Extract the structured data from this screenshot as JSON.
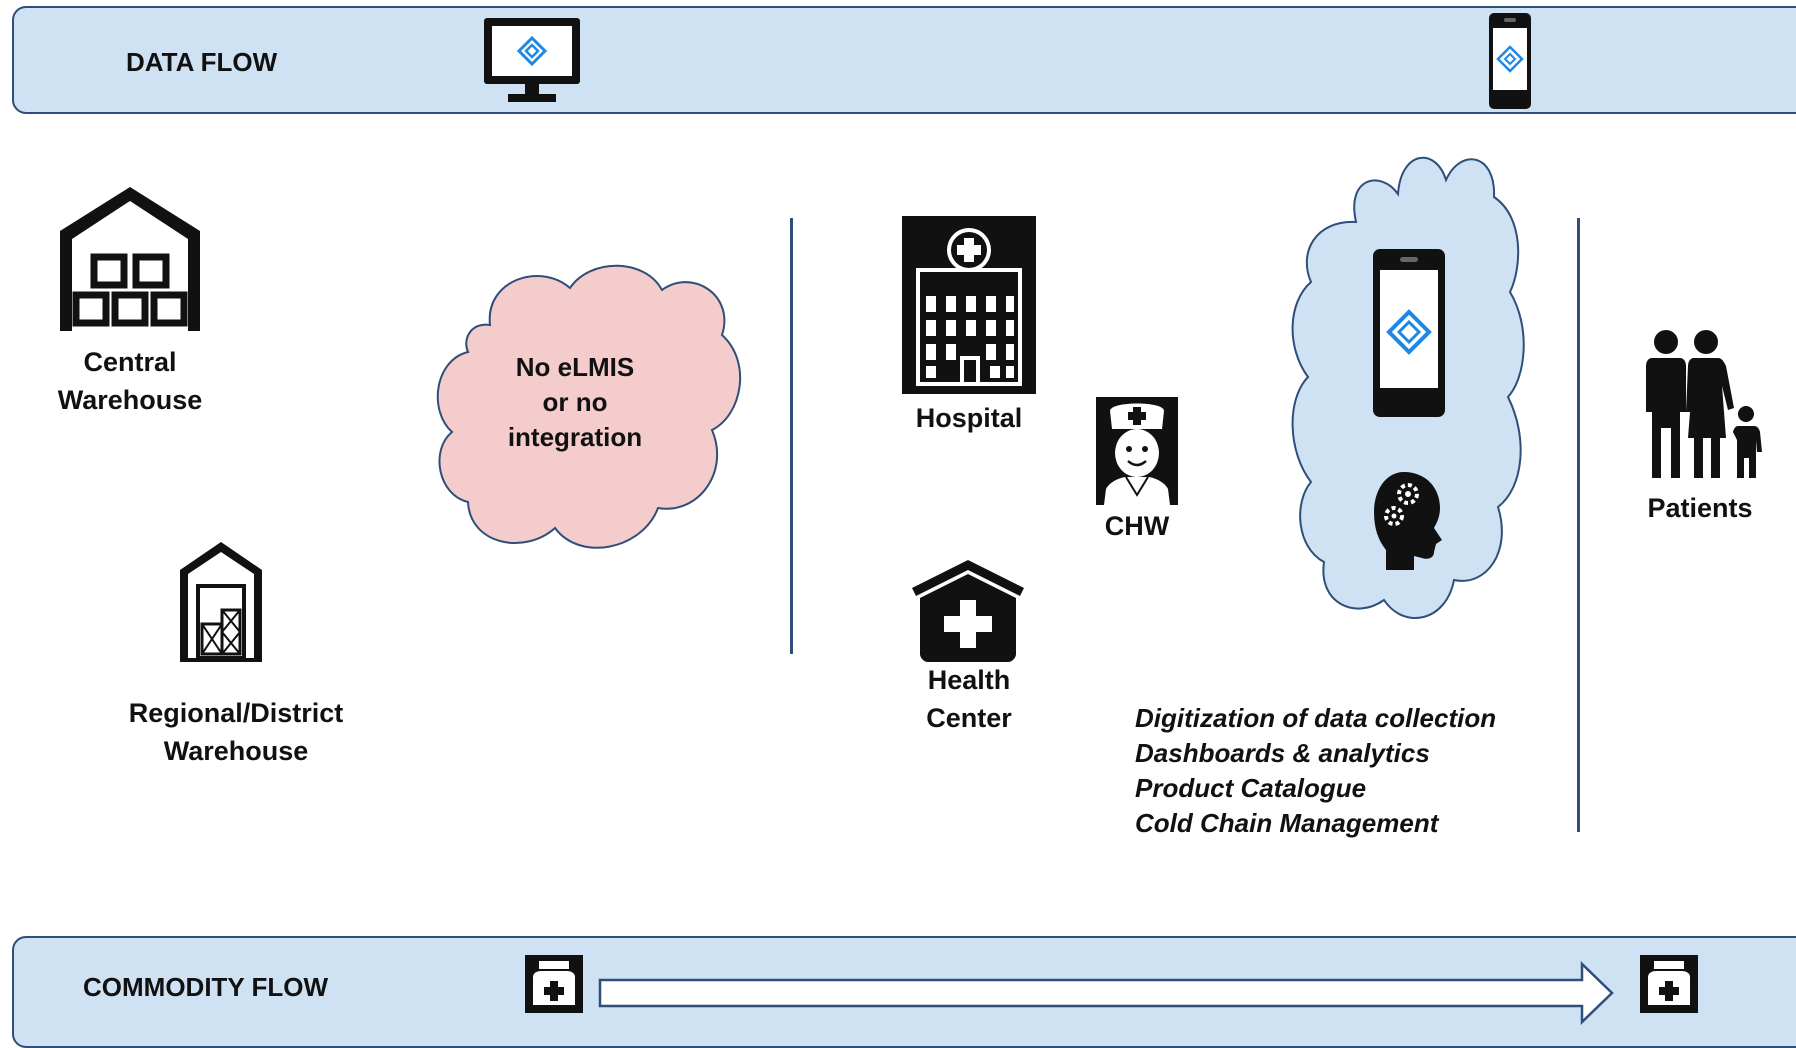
{
  "data_flow": {
    "label": "DATA FLOW",
    "icons": [
      "desktop-monitor-icon",
      "mobile-phone-icon"
    ]
  },
  "commodity_flow": {
    "label": "COMMODITY FLOW",
    "icons": [
      "medicine-kit-icon",
      "arrow-right-icon",
      "medicine-kit-icon"
    ]
  },
  "nodes": {
    "central_warehouse": {
      "line1": "Central",
      "line2": "Warehouse",
      "icon": "warehouse-icon"
    },
    "regional_warehouse": {
      "line1": "Regional/District",
      "line2": "Warehouse",
      "icon": "storage-shed-icon"
    },
    "no_elmis": {
      "line1": "No eLMIS",
      "line2": "or no",
      "line3": "integration",
      "icon": "cloud-icon"
    },
    "hospital": {
      "label": "Hospital",
      "icon": "hospital-building-icon"
    },
    "health_center": {
      "line1": "Health",
      "line2": "Center",
      "icon": "health-center-icon"
    },
    "chw": {
      "label": "CHW",
      "icon": "nurse-icon"
    },
    "patients": {
      "label": "Patients",
      "icon": "family-icon"
    }
  },
  "digital_cloud": {
    "icons": [
      "mobile-phone-icon",
      "brain-gears-icon"
    ]
  },
  "features": [
    "Digitization of data collection",
    "Dashboards & analytics",
    "Product Catalogue",
    "Cold Chain Management"
  ],
  "colors": {
    "band_fill": "#cfe2f3",
    "band_border": "#2f4e7a",
    "pink_cloud": "#f4cccc",
    "blue_cloud": "#cfe2f3",
    "divider": "#2f4e7a",
    "logo_blue": "#1e88e5"
  }
}
